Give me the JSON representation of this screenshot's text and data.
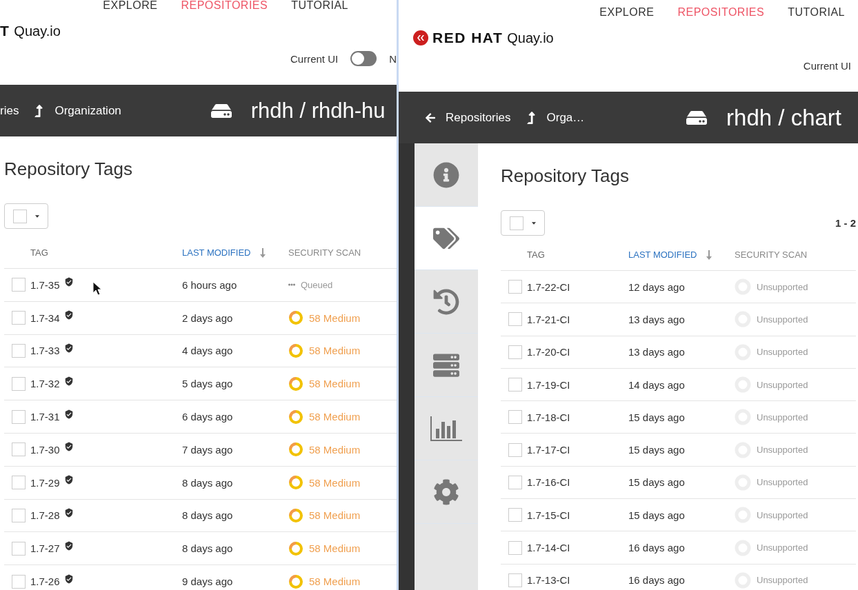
{
  "windows": [
    {
      "header": {
        "nav": [
          {
            "label": "EXPLORE",
            "selected": false
          },
          {
            "label": "REPOSITORIES",
            "selected": true
          },
          {
            "label": "TUTORIAL",
            "selected": false
          }
        ],
        "logo": {
          "brand": "T",
          "product": "Quay.io"
        },
        "ui_switch": {
          "label": "Current UI",
          "on": false,
          "next_label": "N"
        }
      },
      "breadcrumbs": [
        {
          "kind": "plain",
          "label": "ries"
        },
        {
          "kind": "up",
          "label": "Organization"
        }
      ],
      "repository": "rhdh / rhdh-hu",
      "section_title": "Repository Tags",
      "columns": [
        {
          "label": "TAG",
          "sorted": false
        },
        {
          "label": "LAST MODIFIED",
          "sorted": true
        },
        {
          "label": "SECURITY SCAN",
          "sorted": false
        }
      ],
      "rows": [
        {
          "checked": false,
          "tag": "1.7-35",
          "signed": true,
          "modified": "6 hours ago",
          "scan": {
            "kind": "queued",
            "text": "Queued"
          }
        },
        {
          "checked": false,
          "tag": "1.7-34",
          "signed": true,
          "modified": "2 days ago",
          "scan": {
            "kind": "medium",
            "text": "58 Medium"
          }
        },
        {
          "checked": false,
          "tag": "1.7-33",
          "signed": true,
          "modified": "4 days ago",
          "scan": {
            "kind": "medium",
            "text": "58 Medium"
          }
        },
        {
          "checked": false,
          "tag": "1.7-32",
          "signed": true,
          "modified": "5 days ago",
          "scan": {
            "kind": "medium",
            "text": "58 Medium"
          }
        },
        {
          "checked": false,
          "tag": "1.7-31",
          "signed": true,
          "modified": "6 days ago",
          "scan": {
            "kind": "medium",
            "text": "58 Medium"
          }
        },
        {
          "checked": false,
          "tag": "1.7-30",
          "signed": true,
          "modified": "7 days ago",
          "scan": {
            "kind": "medium",
            "text": "58 Medium"
          }
        },
        {
          "checked": false,
          "tag": "1.7-29",
          "signed": true,
          "modified": "8 days ago",
          "scan": {
            "kind": "medium",
            "text": "58 Medium"
          }
        },
        {
          "checked": false,
          "tag": "1.7-28",
          "signed": true,
          "modified": "8 days ago",
          "scan": {
            "kind": "medium",
            "text": "58 Medium"
          }
        },
        {
          "checked": false,
          "tag": "1.7-27",
          "signed": true,
          "modified": "8 days ago",
          "scan": {
            "kind": "medium",
            "text": "58 Medium"
          }
        },
        {
          "checked": false,
          "tag": "1.7-26",
          "signed": true,
          "modified": "9 days ago",
          "scan": {
            "kind": "medium",
            "text": "58 Medium"
          }
        }
      ]
    },
    {
      "header": {
        "nav": [
          {
            "label": "EXPLORE",
            "selected": false
          },
          {
            "label": "REPOSITORIES",
            "selected": true
          },
          {
            "label": "TUTORIAL",
            "selected": false
          }
        ],
        "logo": {
          "emblem": true,
          "brand": "RED HAT",
          "product": "Quay.io"
        },
        "ui_switch": {
          "label": "Current UI"
        }
      },
      "breadcrumbs": [
        {
          "kind": "back",
          "label": "Repositories"
        },
        {
          "kind": "up",
          "label": "Orga…"
        }
      ],
      "repository": "rhdh / chart",
      "sidebar": [
        {
          "kind": "info",
          "selected": false
        },
        {
          "kind": "tags",
          "selected": true
        },
        {
          "kind": "history",
          "selected": false
        },
        {
          "kind": "builds",
          "selected": false
        },
        {
          "kind": "usage",
          "selected": false
        },
        {
          "kind": "settings",
          "selected": false
        }
      ],
      "section_title": "Repository Tags",
      "pager": "1 - 2",
      "columns": [
        {
          "label": "TAG",
          "sorted": false
        },
        {
          "label": "LAST MODIFIED",
          "sorted": true
        },
        {
          "label": "SECURITY SCAN",
          "sorted": false
        }
      ],
      "rows": [
        {
          "checked": false,
          "tag": "1.7-22-CI",
          "signed": false,
          "modified": "12 days ago",
          "scan": {
            "kind": "unsupported",
            "text": "Unsupported"
          }
        },
        {
          "checked": false,
          "tag": "1.7-21-CI",
          "signed": false,
          "modified": "13 days ago",
          "scan": {
            "kind": "unsupported",
            "text": "Unsupported"
          }
        },
        {
          "checked": false,
          "tag": "1.7-20-CI",
          "signed": false,
          "modified": "13 days ago",
          "scan": {
            "kind": "unsupported",
            "text": "Unsupported"
          }
        },
        {
          "checked": false,
          "tag": "1.7-19-CI",
          "signed": false,
          "modified": "14 days ago",
          "scan": {
            "kind": "unsupported",
            "text": "Unsupported"
          }
        },
        {
          "checked": false,
          "tag": "1.7-18-CI",
          "signed": false,
          "modified": "15 days ago",
          "scan": {
            "kind": "unsupported",
            "text": "Unsupported"
          }
        },
        {
          "checked": false,
          "tag": "1.7-17-CI",
          "signed": false,
          "modified": "15 days ago",
          "scan": {
            "kind": "unsupported",
            "text": "Unsupported"
          }
        },
        {
          "checked": false,
          "tag": "1.7-16-CI",
          "signed": false,
          "modified": "15 days ago",
          "scan": {
            "kind": "unsupported",
            "text": "Unsupported"
          }
        },
        {
          "checked": false,
          "tag": "1.7-15-CI",
          "signed": false,
          "modified": "15 days ago",
          "scan": {
            "kind": "unsupported",
            "text": "Unsupported"
          }
        },
        {
          "checked": false,
          "tag": "1.7-14-CI",
          "signed": false,
          "modified": "16 days ago",
          "scan": {
            "kind": "unsupported",
            "text": "Unsupported"
          }
        },
        {
          "checked": false,
          "tag": "1.7-13-CI",
          "signed": false,
          "modified": "16 days ago",
          "scan": {
            "kind": "unsupported",
            "text": "Unsupported"
          }
        }
      ]
    }
  ]
}
